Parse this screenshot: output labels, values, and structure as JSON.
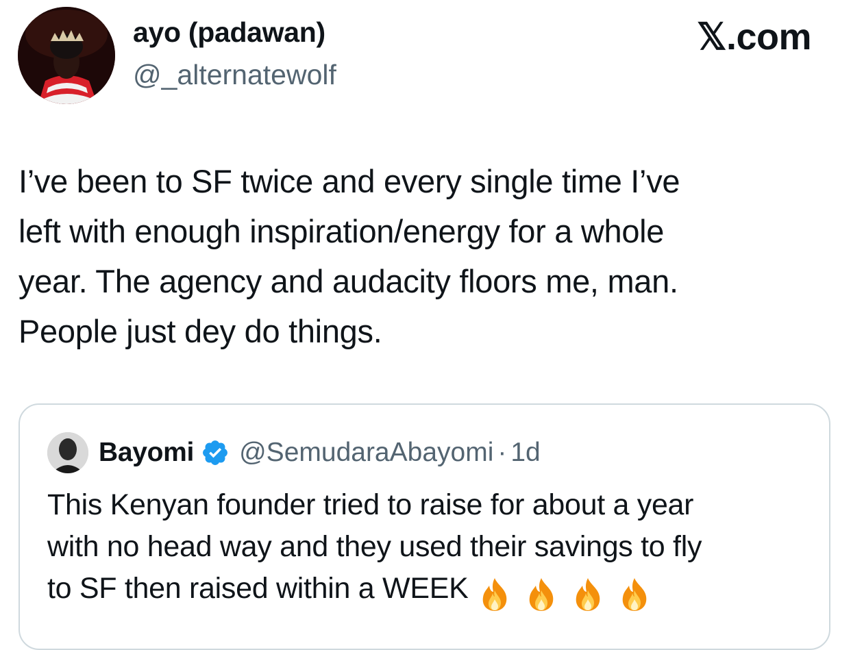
{
  "post": {
    "author": {
      "display_name": "ayo (padawan)",
      "handle": "@_alternatewolf",
      "avatar_icon": "profile-avatar"
    },
    "brand": "𝕏.com",
    "text_lines": [
      "I’ve been to SF twice and every single time I’ve",
      "left with enough inspiration/energy for a whole",
      "year. The agency and audacity floors me, man.",
      "People just dey do things."
    ]
  },
  "quoted_post": {
    "author": {
      "display_name": "Bayomi",
      "verified_icon": "verified-badge-icon",
      "handle": "@SemudaraAbayomi",
      "separator": "·",
      "time": "1d"
    },
    "text_lines": [
      "This Kenyan founder tried to raise for about a year",
      "with no head way and they used their savings to fly",
      "to SF then raised within a WEEK"
    ],
    "emoji": [
      "fire-icon",
      "fire-icon",
      "fire-icon",
      "fire-icon"
    ]
  },
  "colors": {
    "text": "#0f1419",
    "secondary": "#536471",
    "border": "#cfd9de",
    "verified": "#1d9bf0"
  }
}
